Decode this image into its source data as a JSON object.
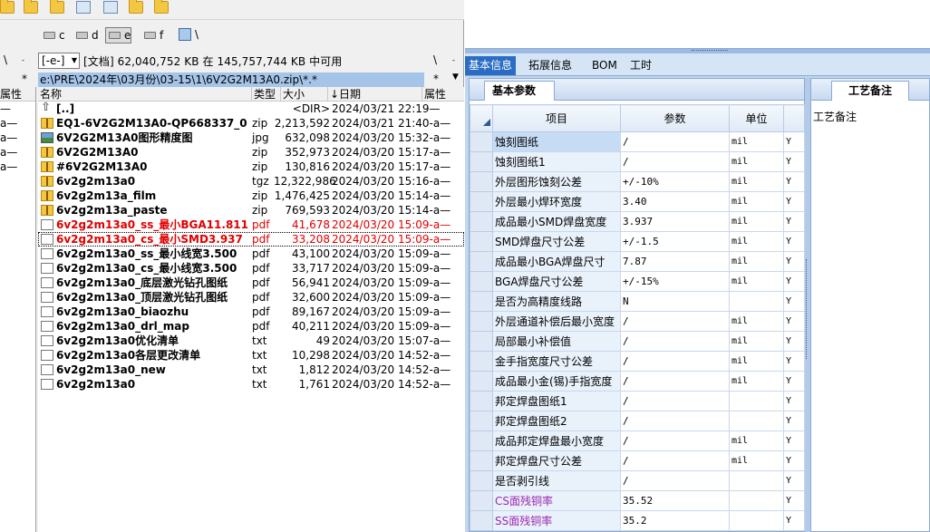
{
  "tc": {
    "drives": [
      "c",
      "d",
      "e",
      "f"
    ],
    "net_label": "\\",
    "side_marks": {
      "left": "\\",
      "left_star": "*",
      "right": "\\",
      "right_star": "*",
      "dash": "-",
      "dash_right": "-"
    },
    "drive_select": "[-e-]",
    "free_info": "[文档]  62,040,752 KB 在 145,757,744 KB 中可用",
    "path": "e:\\PRE\\2024年\\03月份\\03-15\\1\\6V2G2M13A0.zip\\*.*",
    "left_pane": {
      "header": "属性",
      "rows": [
        "—",
        "a—",
        "a—",
        "a—",
        "a—"
      ]
    },
    "columns": {
      "name": "名称",
      "type": "类型",
      "size": "大小",
      "date": "↓日期",
      "attr": "属性"
    },
    "files": [
      {
        "name": "[..]",
        "ext": "",
        "size": "<DIR>",
        "date": "2024/03/21 22:19—",
        "icon": "up",
        "color": "normal"
      },
      {
        "name": "EQ1-6V2G2M13A0-QP668337_0",
        "ext": "zip",
        "size": "2,213,592",
        "date": "2024/03/21 21:40-a—",
        "icon": "zip",
        "color": "normal"
      },
      {
        "name": "6V2G2M13A0图形精度图",
        "ext": "jpg",
        "size": "632,098",
        "date": "2024/03/20 15:32-a—",
        "icon": "img",
        "color": "normal"
      },
      {
        "name": "6V2G2M13A0",
        "ext": "zip",
        "size": "352,973",
        "date": "2024/03/20 15:17-a—",
        "icon": "zip",
        "color": "normal"
      },
      {
        "name": "#6V2G2M13A0",
        "ext": "zip",
        "size": "130,816",
        "date": "2024/03/20 15:17-a—",
        "icon": "zip",
        "color": "normal"
      },
      {
        "name": "6v2g2m13a0",
        "ext": "tgz",
        "size": "12,322,986",
        "date": "2024/03/20 15:16-a—",
        "icon": "zip",
        "color": "normal"
      },
      {
        "name": "6v2g2m13a_film",
        "ext": "zip",
        "size": "1,476,425",
        "date": "2024/03/20 15:14-a—",
        "icon": "zip",
        "color": "normal"
      },
      {
        "name": "6v2g2m13a_paste",
        "ext": "zip",
        "size": "769,593",
        "date": "2024/03/20 15:14-a—",
        "icon": "zip",
        "color": "normal"
      },
      {
        "name": "6v2g2m13a0_ss_最小BGA11.811",
        "ext": "pdf",
        "size": "41,678",
        "date": "2024/03/20 15:09-a—",
        "icon": "doc",
        "color": "red"
      },
      {
        "name": "6v2g2m13a0_cs_最小SMD3.937",
        "ext": "pdf",
        "size": "33,208",
        "date": "2024/03/20 15:09-a—",
        "icon": "doc",
        "color": "red"
      },
      {
        "name": "6v2g2m13a0_ss_最小线宽3.500",
        "ext": "pdf",
        "size": "43,100",
        "date": "2024/03/20 15:09-a—",
        "icon": "doc",
        "color": "normal"
      },
      {
        "name": "6v2g2m13a0_cs_最小线宽3.500",
        "ext": "pdf",
        "size": "33,717",
        "date": "2024/03/20 15:09-a—",
        "icon": "doc",
        "color": "normal"
      },
      {
        "name": "6v2g2m13a0_底层激光钻孔图纸",
        "ext": "pdf",
        "size": "56,941",
        "date": "2024/03/20 15:09-a—",
        "icon": "doc",
        "color": "normal"
      },
      {
        "name": "6v2g2m13a0_顶层激光钻孔图纸",
        "ext": "pdf",
        "size": "32,600",
        "date": "2024/03/20 15:09-a—",
        "icon": "doc",
        "color": "normal"
      },
      {
        "name": "6v2g2m13a0_biaozhu",
        "ext": "pdf",
        "size": "89,167",
        "date": "2024/03/20 15:09-a—",
        "icon": "doc",
        "color": "normal"
      },
      {
        "name": "6v2g2m13a0_drl_map",
        "ext": "pdf",
        "size": "40,211",
        "date": "2024/03/20 15:09-a—",
        "icon": "doc",
        "color": "normal"
      },
      {
        "name": "6v2g2m13a0优化清单",
        "ext": "txt",
        "size": "49",
        "date": "2024/03/20 15:07-a—",
        "icon": "doc",
        "color": "normal"
      },
      {
        "name": "6v2g2m13a0各层更改清单",
        "ext": "txt",
        "size": "10,298",
        "date": "2024/03/20 14:52-a—",
        "icon": "doc",
        "color": "normal"
      },
      {
        "name": "6v2g2m13a0_new",
        "ext": "txt",
        "size": "1,812",
        "date": "2024/03/20 14:52-a—",
        "icon": "doc",
        "color": "normal"
      },
      {
        "name": "6v2g2m13a0",
        "ext": "txt",
        "size": "1,761",
        "date": "2024/03/20 14:52-a—",
        "icon": "doc",
        "color": "normal"
      }
    ],
    "selected_index": 9
  },
  "erp": {
    "tabs": [
      "基本信息",
      "拓展信息",
      "BOM",
      "工时"
    ],
    "active_tab": 0,
    "left_subtab": "基本参数",
    "right_subtab": "工艺备注",
    "right_label": "工艺备注",
    "grid_headers": [
      "项目",
      "参数",
      "单位"
    ],
    "rows": [
      {
        "label": "蚀刻图纸",
        "value": "/",
        "unit": "mil",
        "flag": "Y",
        "color": "normal"
      },
      {
        "label": "蚀刻图纸1",
        "value": "/",
        "unit": "mil",
        "flag": "Y",
        "color": "normal"
      },
      {
        "label": "外层图形蚀刻公差",
        "value": "+/-10%",
        "unit": "mil",
        "flag": "Y",
        "color": "normal"
      },
      {
        "label": "外层最小焊环宽度",
        "value": "3.40",
        "unit": "mil",
        "flag": "Y",
        "color": "normal"
      },
      {
        "label": "成品最小SMD焊盘宽度",
        "value": "3.937",
        "unit": "mil",
        "flag": "Y",
        "color": "normal"
      },
      {
        "label": "SMD焊盘尺寸公差",
        "value": "+/-1.5",
        "unit": "mil",
        "flag": "Y",
        "color": "normal"
      },
      {
        "label": "成品最小BGA焊盘尺寸",
        "value": "7.87",
        "unit": "mil",
        "flag": "Y",
        "color": "normal"
      },
      {
        "label": "BGA焊盘尺寸公差",
        "value": "+/-15%",
        "unit": "mil",
        "flag": "Y",
        "color": "normal"
      },
      {
        "label": "是否为高精度线路",
        "value": "N",
        "unit": "",
        "flag": "Y",
        "color": "normal"
      },
      {
        "label": "外层通道补偿后最小宽度",
        "value": "/",
        "unit": "mil",
        "flag": "Y",
        "color": "normal"
      },
      {
        "label": "局部最小补偿值",
        "value": "/",
        "unit": "mil",
        "flag": "Y",
        "color": "normal"
      },
      {
        "label": "金手指宽度尺寸公差",
        "value": "/",
        "unit": "mil",
        "flag": "Y",
        "color": "normal"
      },
      {
        "label": "成品最小金(锡)手指宽度",
        "value": "/",
        "unit": "mil",
        "flag": "Y",
        "color": "normal"
      },
      {
        "label": "邦定焊盘图纸1",
        "value": "/",
        "unit": "",
        "flag": "Y",
        "color": "normal"
      },
      {
        "label": "邦定焊盘图纸2",
        "value": "/",
        "unit": "",
        "flag": "Y",
        "color": "normal"
      },
      {
        "label": "成品邦定焊盘最小宽度",
        "value": "/",
        "unit": "mil",
        "flag": "Y",
        "color": "normal"
      },
      {
        "label": "邦定焊盘尺寸公差",
        "value": "/",
        "unit": "mil",
        "flag": "Y",
        "color": "normal"
      },
      {
        "label": "是否剥引线",
        "value": "/",
        "unit": "",
        "flag": "Y",
        "color": "normal"
      },
      {
        "label": "CS面残铜率",
        "value": "35.52",
        "unit": "",
        "flag": "Y",
        "color": "purple"
      },
      {
        "label": "SS面残铜率",
        "value": "35.2",
        "unit": "",
        "flag": "Y",
        "color": "purple"
      }
    ]
  }
}
